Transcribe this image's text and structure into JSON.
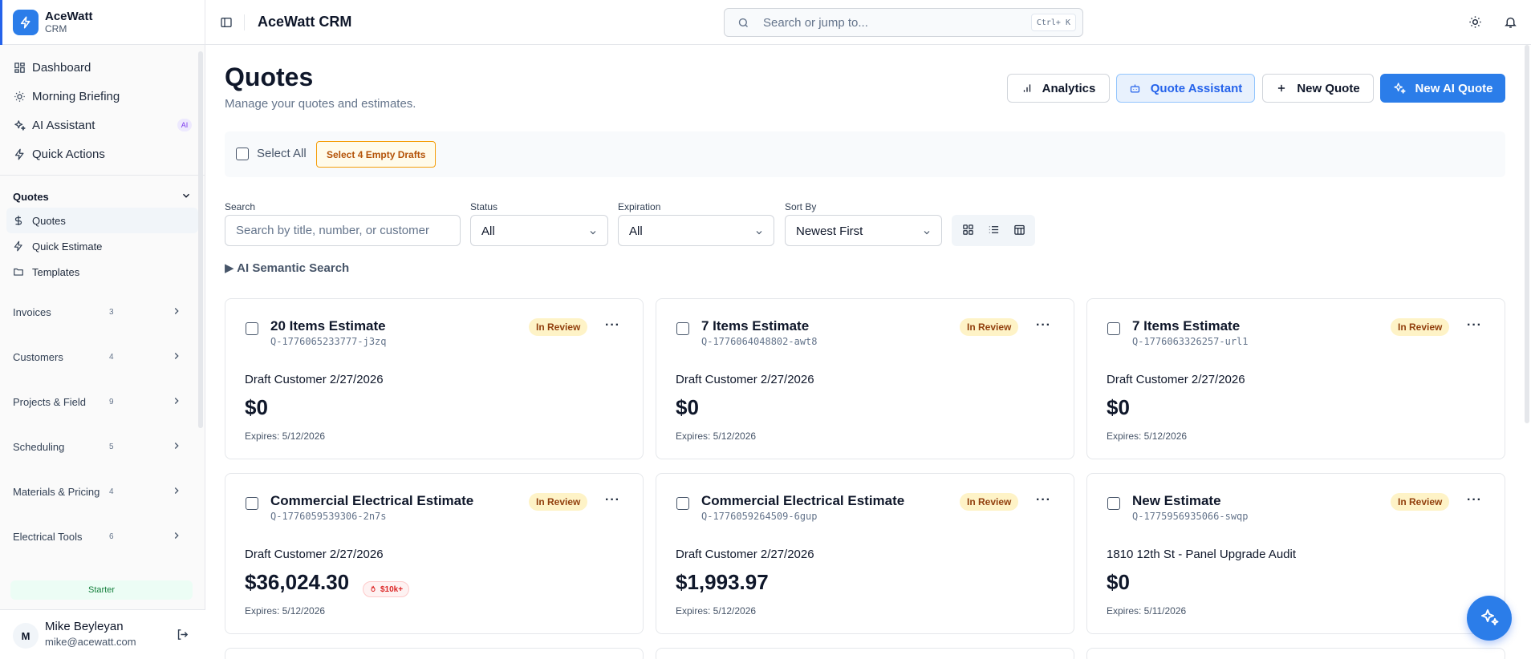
{
  "brand": {
    "name": "AceWatt",
    "sub": "CRM"
  },
  "nav": {
    "dashboard": "Dashboard",
    "briefing": "Morning Briefing",
    "assistant": "AI Assistant",
    "assistant_badge": "AI",
    "quick_actions": "Quick Actions"
  },
  "quotes_section": {
    "title": "Quotes",
    "items": [
      "Quotes",
      "Quick Estimate",
      "Templates"
    ]
  },
  "groups": [
    {
      "label": "Invoices",
      "count": "3"
    },
    {
      "label": "Customers",
      "count": "4"
    },
    {
      "label": "Projects & Field",
      "count": "9"
    },
    {
      "label": "Scheduling",
      "count": "5"
    },
    {
      "label": "Materials & Pricing",
      "count": "4"
    },
    {
      "label": "Electrical Tools",
      "count": "6"
    }
  ],
  "plan": "Starter",
  "user": {
    "initial": "M",
    "name": "Mike Beyleyan",
    "email": "mike@acewatt.com"
  },
  "header": {
    "title": "AceWatt CRM",
    "search_placeholder": "Search or jump to...",
    "shortcut": "Ctrl+ K"
  },
  "page": {
    "title": "Quotes",
    "subtitle": "Manage your quotes and estimates."
  },
  "actions": {
    "analytics": "Analytics",
    "assistant": "Quote Assistant",
    "new_quote": "New Quote",
    "new_ai_quote": "New AI Quote"
  },
  "selection": {
    "select_all": "Select All",
    "drafts": "Select 4 Empty Drafts"
  },
  "filters": {
    "search_label": "Search",
    "search_placeholder": "Search by title, number, or customer",
    "status_label": "Status",
    "status_value": "All",
    "expiration_label": "Expiration",
    "expiration_value": "All",
    "sort_label": "Sort By",
    "sort_value": "Newest First"
  },
  "semantic_search": "▶ AI Semantic Search",
  "quotes": [
    {
      "title": "20 Items Estimate",
      "number": "Q-1776065233777-j3zq",
      "status": "In Review",
      "customer": "Draft Customer 2/27/2026",
      "amount": "$0",
      "expires": "Expires: 5/12/2026"
    },
    {
      "title": "7 Items Estimate",
      "number": "Q-1776064048802-awt8",
      "status": "In Review",
      "customer": "Draft Customer 2/27/2026",
      "amount": "$0",
      "expires": "Expires: 5/12/2026"
    },
    {
      "title": "7 Items Estimate",
      "number": "Q-1776063326257-url1",
      "status": "In Review",
      "customer": "Draft Customer 2/27/2026",
      "amount": "$0",
      "expires": "Expires: 5/12/2026"
    },
    {
      "title": "Commercial Electrical Estimate",
      "number": "Q-1776059539306-2n7s",
      "status": "In Review",
      "customer": "Draft Customer 2/27/2026",
      "amount": "$36,024.30",
      "hot": "$10k+",
      "expires": "Expires: 5/12/2026"
    },
    {
      "title": "Commercial Electrical Estimate",
      "number": "Q-1776059264509-6gup",
      "status": "In Review",
      "customer": "Draft Customer 2/27/2026",
      "amount": "$1,993.97",
      "expires": "Expires: 5/12/2026"
    },
    {
      "title": "New Estimate",
      "number": "Q-1775956935066-swqp",
      "status": "In Review",
      "customer": "1810 12th St - Panel Upgrade Audit",
      "amount": "$0",
      "expires": "Expires: 5/11/2026"
    }
  ],
  "colors": {
    "accent": "#2b7de9",
    "badge_bg": "#fef3c7",
    "badge_text": "#92400e",
    "hot": "#dc2626"
  }
}
